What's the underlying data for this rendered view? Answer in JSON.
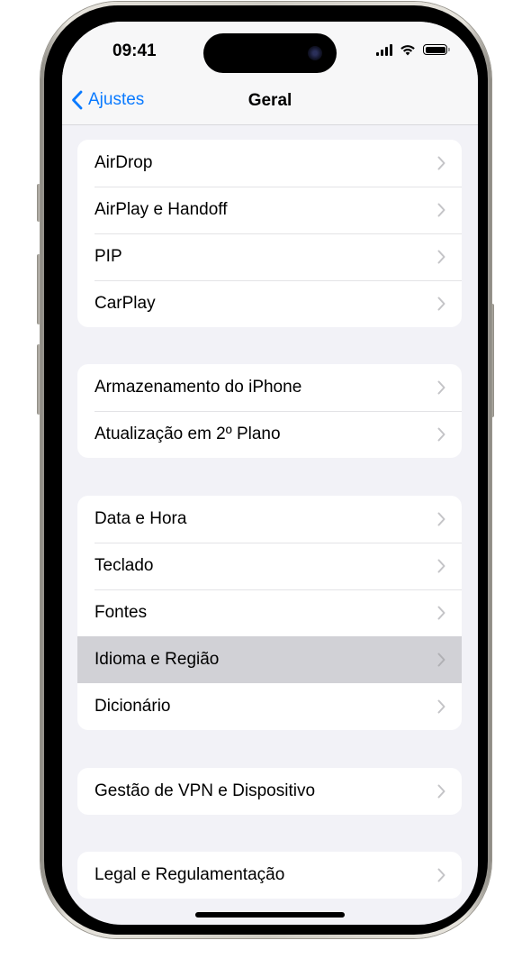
{
  "status_bar": {
    "time": "09:41",
    "icons": [
      "cellular-signal-icon",
      "wifi-icon",
      "battery-icon"
    ],
    "battery_level_percent": 100
  },
  "nav": {
    "back_label": "Ajustes",
    "title": "Geral",
    "accent_color": "#0a7aff"
  },
  "groups": [
    {
      "items": [
        {
          "label": "AirDrop"
        },
        {
          "label": "AirPlay e Handoff"
        },
        {
          "label": "PIP"
        },
        {
          "label": "CarPlay"
        }
      ]
    },
    {
      "items": [
        {
          "label": "Armazenamento do iPhone"
        },
        {
          "label": "Atualização em 2º Plano"
        }
      ]
    },
    {
      "items": [
        {
          "label": "Data e Hora"
        },
        {
          "label": "Teclado"
        },
        {
          "label": "Fontes"
        },
        {
          "label": "Idioma e Região",
          "selected": true
        },
        {
          "label": "Dicionário"
        }
      ]
    },
    {
      "items": [
        {
          "label": "Gestão de VPN e Dispositivo"
        }
      ]
    },
    {
      "items": [
        {
          "label": "Legal e Regulamentação"
        }
      ]
    }
  ],
  "colors": {
    "background": "#f2f2f7",
    "cell": "#ffffff",
    "selected_cell": "#d1d1d6",
    "chevron": "#c4c4c7"
  }
}
